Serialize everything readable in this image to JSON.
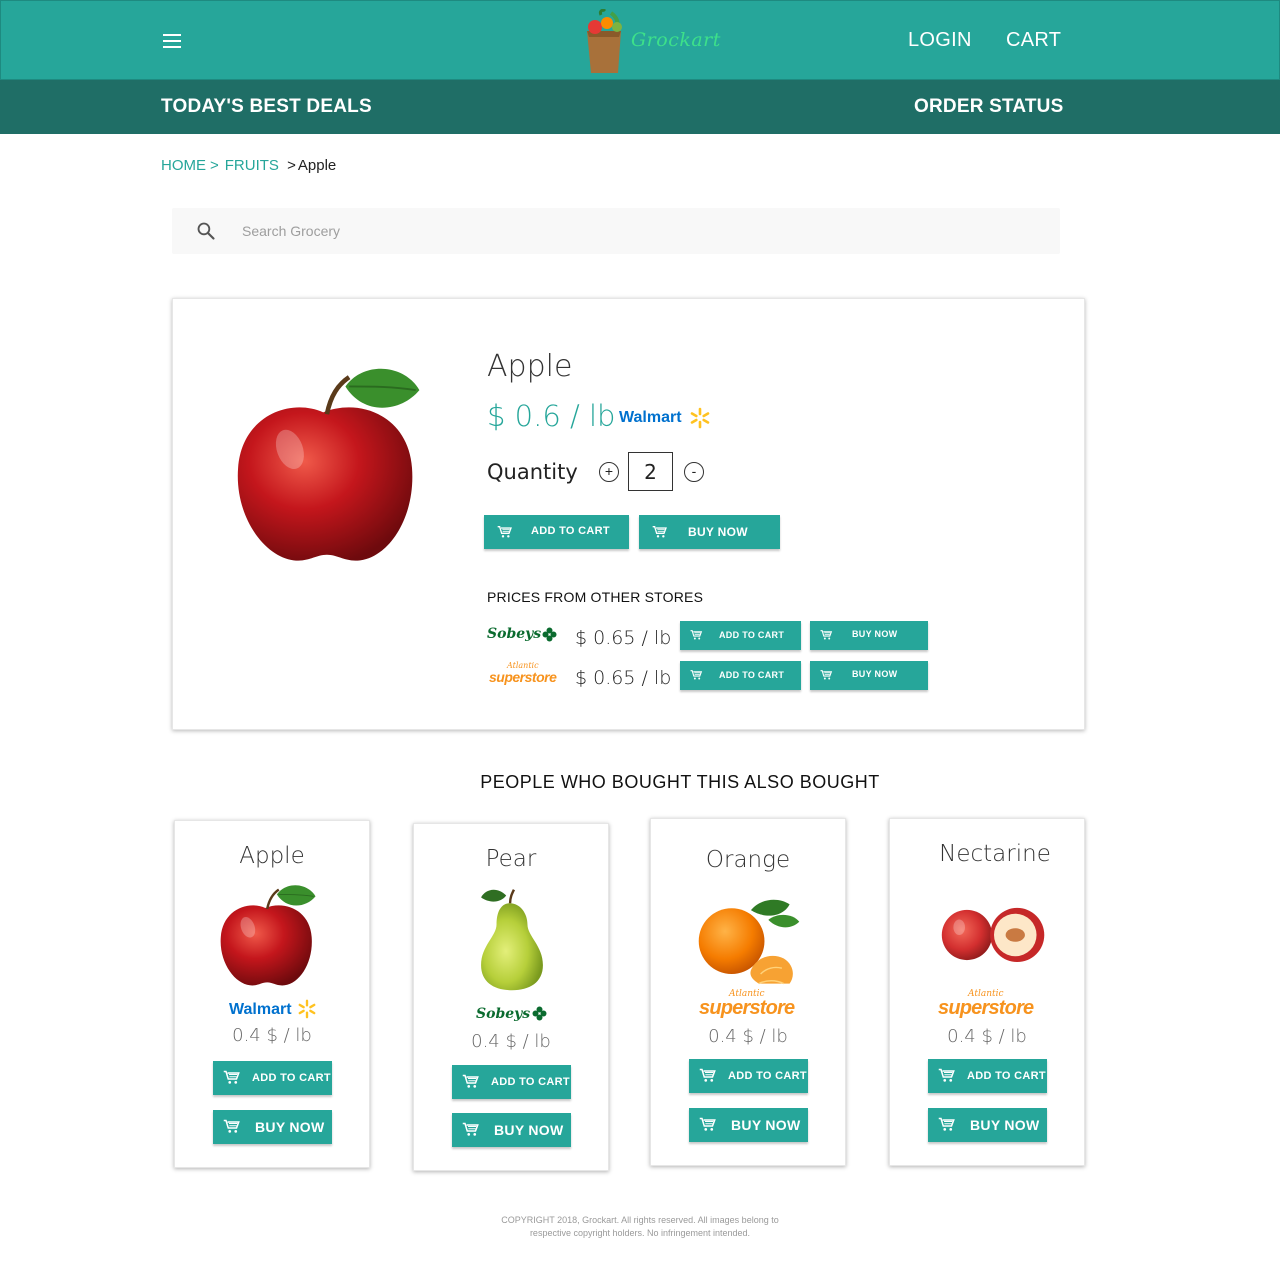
{
  "colors": {
    "accent": "#26a69a",
    "accent_dark": "#1f6e66",
    "walmart_blue": "#0071ce",
    "walmart_yellow": "#ffc220",
    "sobeys_green": "#0b6b2f",
    "superstore_orange": "#f7931e"
  },
  "header": {
    "menu_icon": "hamburger-menu-icon",
    "logo_text": "Grockart",
    "login_label": "LOGIN",
    "cart_label": "CART",
    "deals_label": "TODAY'S BEST DEALS",
    "order_status_label": "ORDER STATUS"
  },
  "breadcrumb": {
    "home": "HOME",
    "category": "FRUITS",
    "current": "Apple",
    "separator": ">"
  },
  "search": {
    "placeholder": "Search Grocery",
    "icon": "search-icon"
  },
  "product": {
    "name": "Apple",
    "price": "$ 0.6 / lb",
    "store": "Walmart",
    "quantity_label": "Quantity",
    "quantity": "2",
    "plus": "+",
    "minus": "-",
    "add_to_cart": "ADD TO CART",
    "buy_now": "BUY NOW",
    "other_title": "PRICES FROM OTHER STORES",
    "other_stores": [
      {
        "store": "Sobeys",
        "price": "$ 0.65 / lb",
        "add_to_cart": "ADD TO CART",
        "buy_now": "BUY NOW"
      },
      {
        "store": "superstore",
        "store_tag": "Atlantic",
        "price": "$ 0.65 / lb",
        "add_to_cart": "ADD TO CART",
        "buy_now": "BUY NOW"
      }
    ]
  },
  "recommendations": {
    "title": "PEOPLE WHO BOUGHT THIS ALSO BOUGHT",
    "items": [
      {
        "name": "Apple",
        "store": "Walmart",
        "price": "0.4 $ / lb",
        "add_to_cart": "ADD TO CART",
        "buy_now": "BUY NOW"
      },
      {
        "name": "Pear",
        "store": "Sobeys",
        "price": "0.4 $ / lb",
        "add_to_cart": "ADD TO CART",
        "buy_now": "BUY NOW"
      },
      {
        "name": "Orange",
        "store": "superstore",
        "store_tag": "Atlantic",
        "price": "0.4 $ / lb",
        "add_to_cart": "ADD TO CART",
        "buy_now": "BUY NOW"
      },
      {
        "name": "Nectarine",
        "store": "superstore",
        "store_tag": "Atlantic",
        "price": "0.4 $ / lb",
        "add_to_cart": "ADD TO CART",
        "buy_now": "BUY NOW"
      }
    ]
  },
  "footer": {
    "text": "COPYRIGHT 2018, Grockart. All rights reserved. All images belong to respective copyright holders. No infringement intended."
  }
}
